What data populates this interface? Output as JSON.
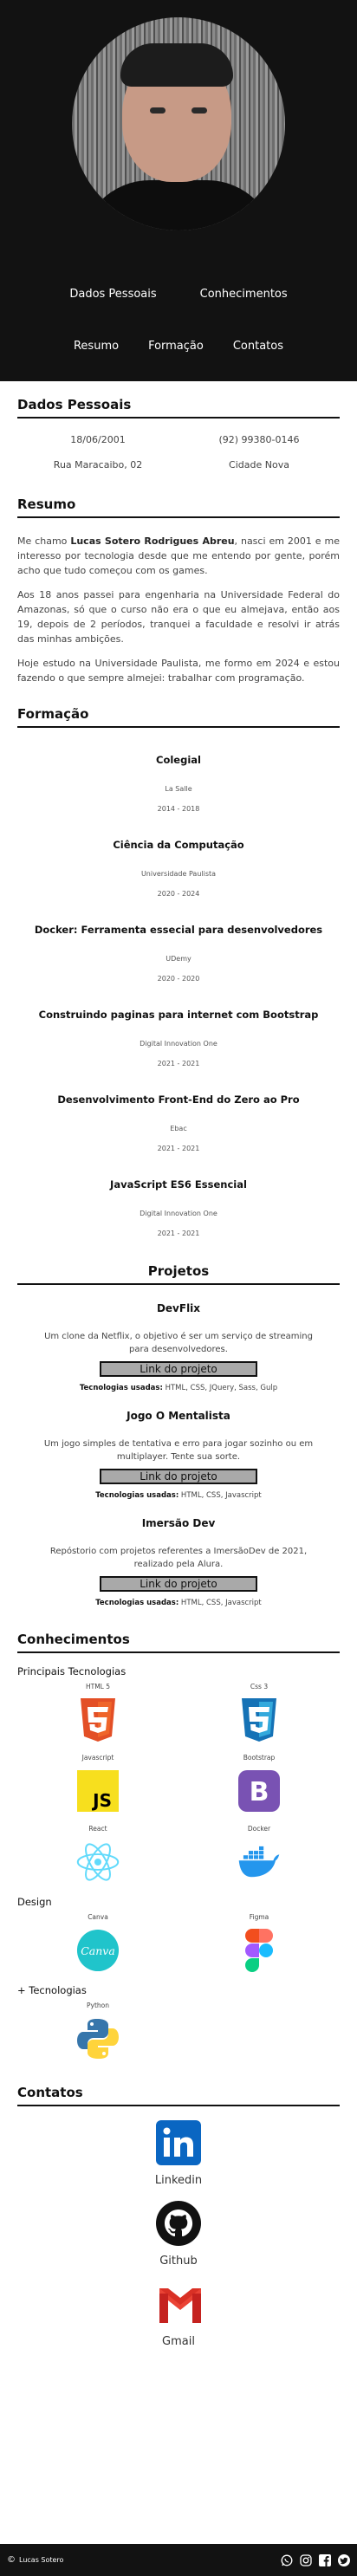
{
  "nav": {
    "dados": "Dados Pessoais",
    "conhecimentos": "Conhecimentos",
    "resumo": "Resumo",
    "formacao": "Formação",
    "contatos": "Contatos"
  },
  "pessoais": {
    "title": "Dados Pessoais",
    "birth": "18/06/2001",
    "phone": "(92) 99380-0146",
    "street": "Rua Maracaibo, 02",
    "city": "Cidade Nova"
  },
  "resumo": {
    "title": "Resumo",
    "p1_a": "Me chamo ",
    "p1_name": "Lucas Sotero Rodrigues Abreu",
    "p1_b": ", nasci em 2001 e me interesso por tecnologia desde que me entendo por gente, porém acho que tudo começou com os games.",
    "p2": "Aos 18 anos passei para engenharia na Universidade Federal do Amazonas, só que o curso não era o que eu almejava, então aos 19, depois de 2 períodos, tranquei a faculdade e resolvi ir atrás das minhas ambições.",
    "p3": "Hoje estudo na Universidade Paulista, me formo em 2024 e estou fazendo o que sempre almejei: trabalhar com programação."
  },
  "formacao": {
    "title": "Formação",
    "courses": [
      {
        "name": "Colegial",
        "inst": "La Salle",
        "dates": "2014 - 2018"
      },
      {
        "name": "Ciência da Computação",
        "inst": "Universidade Paulista",
        "dates": "2020 - 2024"
      },
      {
        "name": "Docker: Ferramenta essecial para desenvolvedores",
        "inst": "UDemy",
        "dates": "2020 - 2020"
      },
      {
        "name": "Construindo paginas para internet com Bootstrap",
        "inst": "Digital Innovation One",
        "dates": "2021 - 2021"
      },
      {
        "name": "Desenvolvimento Front-End do Zero ao Pro",
        "inst": "Ebac",
        "dates": "2021 - 2021"
      },
      {
        "name": "JavaScript ES6 Essencial",
        "inst": "Digital Innovation One",
        "dates": "2021 - 2021"
      }
    ]
  },
  "projetos": {
    "title": "Projetos",
    "link_label": "Link do projeto",
    "tech_label": "Tecnologias usadas:",
    "items": [
      {
        "name": "DevFlix",
        "desc": "Um clone da Netflix, o objetivo é ser um serviço de streaming para desenvolvedores.",
        "tech": " HTML, CSS, JQuery, Sass, Gulp"
      },
      {
        "name": "Jogo O Mentalista",
        "desc": "Um jogo simples de tentativa e erro para jogar sozinho ou em multiplayer. Tente sua sorte.",
        "tech": " HTML, CSS, Javascript"
      },
      {
        "name": "Imersão Dev",
        "desc": "Repóstorio com projetos referentes a ImersãoDev de 2021, realizado pela Alura.",
        "tech": " HTML, CSS, Javascript"
      }
    ]
  },
  "conhecimentos": {
    "title": "Conhecimentos",
    "principais": "Principais Tecnologias",
    "design": "Design",
    "mais": "+ Tecnologias",
    "techs": [
      {
        "name": "HTML 5",
        "icon": "html5-icon"
      },
      {
        "name": "Css 3",
        "icon": "css3-icon"
      },
      {
        "name": "Javascript",
        "icon": "javascript-icon"
      },
      {
        "name": "Bootstrap",
        "icon": "bootstrap-icon"
      },
      {
        "name": "React",
        "icon": "react-icon"
      },
      {
        "name": "Docker",
        "icon": "docker-icon"
      }
    ],
    "design_tools": [
      {
        "name": "Canva",
        "icon": "canva-icon",
        "logo_text": "Canva"
      },
      {
        "name": "Figma",
        "icon": "figma-icon"
      }
    ],
    "more": [
      {
        "name": "Python",
        "icon": "python-icon"
      }
    ]
  },
  "contatos": {
    "title": "Contatos",
    "items": [
      {
        "label": "Linkedin",
        "icon": "linkedin-icon"
      },
      {
        "label": "Github",
        "icon": "github-icon"
      },
      {
        "label": "Gmail",
        "icon": "gmail-icon"
      }
    ]
  },
  "footer": {
    "brand": "Lucas Sotero"
  },
  "colors": {
    "header_bg": "#121212",
    "html5": "#e34f26",
    "css3": "#1572b6",
    "js": "#f7df1e",
    "bootstrap": "#7952b3",
    "react": "#61dafb",
    "docker": "#2496ed",
    "linkedin": "#0a66c2",
    "gmail": "#d93025"
  }
}
